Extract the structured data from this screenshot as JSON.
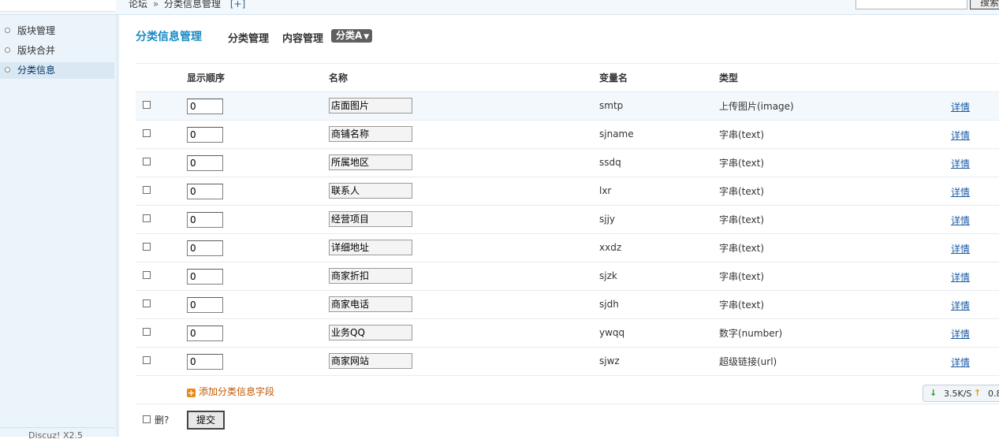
{
  "breadcrumb": {
    "root": "论坛",
    "separator": "»",
    "current": "分类信息管理",
    "expand": "[+]"
  },
  "top_search": {
    "button": "搜索",
    "value": ""
  },
  "sidebar": {
    "items": [
      {
        "label": "版块管理"
      },
      {
        "label": "版块合并"
      },
      {
        "label": "分类信息",
        "active": true
      }
    ],
    "footer": "Discuz! X2.5"
  },
  "page_title": "分类信息管理",
  "tabs": {
    "category_manage": "分类管理",
    "content_manage": "内容管理",
    "dropdown": "分类A"
  },
  "table": {
    "headers": {
      "order": "显示顺序",
      "name": "名称",
      "varname": "变量名",
      "type": "类型"
    },
    "rows": [
      {
        "order": "0",
        "name": "店面图片",
        "varname": "smtp",
        "type": "上传图片(image)",
        "detail": "详情"
      },
      {
        "order": "0",
        "name": "商铺名称",
        "varname": "sjname",
        "type": "字串(text)",
        "detail": "详情"
      },
      {
        "order": "0",
        "name": "所属地区",
        "varname": "ssdq",
        "type": "字串(text)",
        "detail": "详情"
      },
      {
        "order": "0",
        "name": "联系人",
        "varname": "lxr",
        "type": "字串(text)",
        "detail": "详情"
      },
      {
        "order": "0",
        "name": "经营项目",
        "varname": "sjjy",
        "type": "字串(text)",
        "detail": "详情"
      },
      {
        "order": "0",
        "name": "详细地址",
        "varname": "xxdz",
        "type": "字串(text)",
        "detail": "详情"
      },
      {
        "order": "0",
        "name": "商家折扣",
        "varname": "sjzk",
        "type": "字串(text)",
        "detail": "详情"
      },
      {
        "order": "0",
        "name": "商家电话",
        "varname": "sjdh",
        "type": "字串(text)",
        "detail": "详情"
      },
      {
        "order": "0",
        "name": "业务QQ",
        "varname": "ywqq",
        "type": "数字(number)",
        "detail": "详情"
      },
      {
        "order": "0",
        "name": "商家网站",
        "varname": "sjwz",
        "type": "超级链接(url)",
        "detail": "详情"
      }
    ],
    "add_field": "添加分类信息字段",
    "delete_label": "删?",
    "submit": "提交"
  },
  "network_widget": {
    "download": "3.5K/S",
    "upload": "0.8"
  },
  "colors": {
    "title": "#1a8ac3",
    "link": "#1a5aa5",
    "add": "#c05800",
    "sidebar_bg": "#eaf4fa"
  }
}
